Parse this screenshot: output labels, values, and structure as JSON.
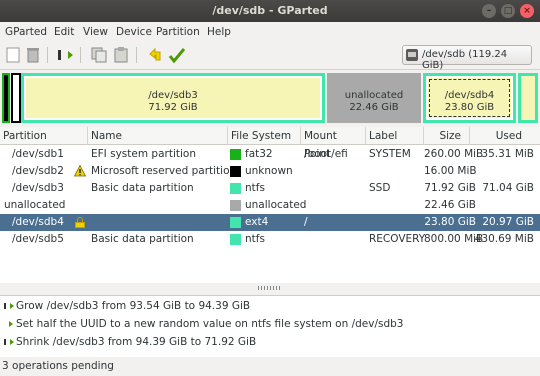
{
  "window": {
    "title": "/dev/sdb - GParted"
  },
  "menu": [
    "GParted",
    "Edit",
    "View",
    "Device",
    "Partition",
    "Help"
  ],
  "toolbar": {
    "device": "/dev/sdb",
    "device_size": "(119.24 GiB)",
    "buttons": [
      "new",
      "delete",
      "resize-move",
      "copy",
      "paste",
      "undo",
      "apply"
    ]
  },
  "graph": {
    "sdb3": {
      "name": "/dev/sdb3",
      "size": "71.92 GiB"
    },
    "unalloc": {
      "name": "unallocated",
      "size": "22.46 GiB"
    },
    "sdb4": {
      "name": "/dev/sdb4",
      "size": "23.80 GiB"
    }
  },
  "columns": [
    "Partition",
    "Name",
    "File System",
    "Mount Point",
    "Label",
    "Size",
    "Used"
  ],
  "rows": [
    {
      "partition": "/dev/sdb1",
      "name": "EFI system partition",
      "fs": "fat32",
      "fs_color": "#18b218",
      "mount": "/boot/efi",
      "label": "SYSTEM",
      "size": "260.00 MiB",
      "used": "35.31 MiB"
    },
    {
      "partition": "/dev/sdb2",
      "name": "Microsoft reserved partition",
      "fs": "unknown",
      "fs_color": "#000000",
      "mount": "",
      "label": "",
      "size": "16.00 MiB",
      "used": ""
    },
    {
      "partition": "/dev/sdb3",
      "name": "Basic data partition",
      "fs": "ntfs",
      "fs_color": "#42e5ac",
      "mount": "",
      "label": "SSD",
      "size": "71.92 GiB",
      "used": "71.04 GiB"
    },
    {
      "partition": "unallocated",
      "name": "",
      "fs": "unallocated",
      "fs_color": "#a9a9a9",
      "mount": "",
      "label": "",
      "size": "22.46 GiB",
      "used": ""
    },
    {
      "partition": "/dev/sdb4",
      "name": "",
      "fs": "ext4",
      "fs_color": "#42e5ac",
      "mount": "/",
      "label": "",
      "size": "23.80 GiB",
      "used": "20.97 GiB"
    },
    {
      "partition": "/dev/sdb5",
      "name": "Basic data partition",
      "fs": "ntfs",
      "fs_color": "#42e5ac",
      "mount": "",
      "label": "RECOVERY",
      "size": "800.00 MiB",
      "used": "430.69 MiB"
    }
  ],
  "operations": [
    "Grow /dev/sdb3 from 93.54 GiB to 94.39 GiB",
    "Set half the UUID to a new random value on ntfs file system on /dev/sdb3",
    "Shrink /dev/sdb3 from 94.39 GiB to 71.92 GiB"
  ],
  "status": "3 operations pending",
  "colors": {
    "selection": "#4a6f91",
    "ntfs": "#42e5ac",
    "fat32": "#18b218",
    "ext4": "#42e5ac"
  }
}
